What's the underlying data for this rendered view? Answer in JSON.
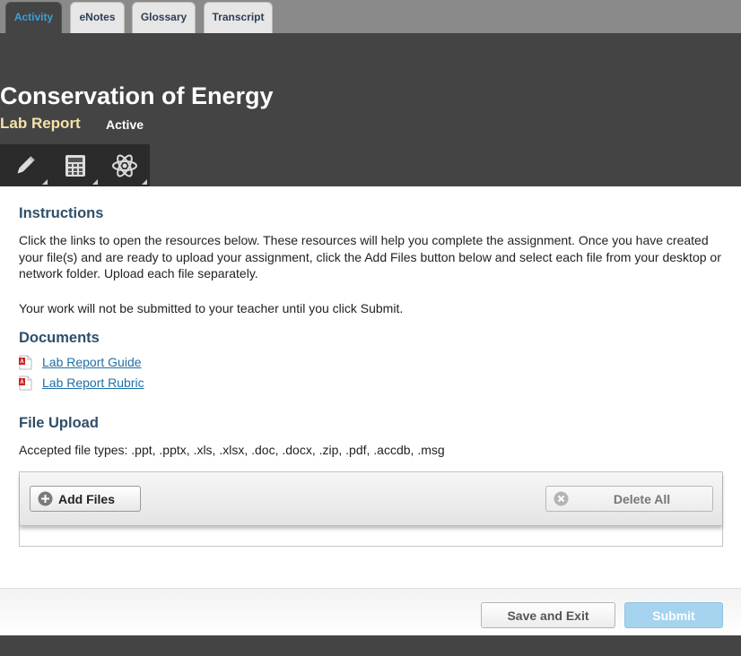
{
  "tabs": [
    {
      "label": "Activity",
      "active": true
    },
    {
      "label": "eNotes",
      "active": false
    },
    {
      "label": "Glossary",
      "active": false
    },
    {
      "label": "Transcript",
      "active": false
    }
  ],
  "header": {
    "title": "Conservation of Energy",
    "subtitle": "Lab Report",
    "status": "Active"
  },
  "toolbar": {
    "tools": [
      {
        "icon": "pencil-icon"
      },
      {
        "icon": "calculator-icon"
      },
      {
        "icon": "atom-icon"
      }
    ]
  },
  "instructions": {
    "heading": "Instructions",
    "text": "Click the links to open the resources below. These resources will help you complete the assignment. Once you have created your file(s) and are ready to upload your assignment, click the Add Files button below and select each file from your desktop or network folder. Upload each file separately.",
    "note": "Your work will not be submitted to your teacher until you click Submit."
  },
  "documents": {
    "heading": "Documents",
    "items": [
      {
        "label": "Lab Report Guide",
        "icon": "pdf-icon"
      },
      {
        "label": "Lab Report Rubric",
        "icon": "pdf-icon"
      }
    ]
  },
  "upload": {
    "heading": "File Upload",
    "accepted": "Accepted file types: .ppt, .pptx, .xls, .xlsx, .doc, .docx, .zip, .pdf, .accdb, .msg",
    "add_label": "Add Files",
    "delete_label": "Delete All"
  },
  "footer": {
    "save_label": "Save and Exit",
    "submit_label": "Submit"
  },
  "colors": {
    "header_bg": "#444444",
    "accent_tab": "#3aa0d6",
    "subtitle": "#f4e2a8",
    "heading": "#2f4f6a",
    "link": "#1f6fa8",
    "submit_disabled": "#a6d4ef"
  }
}
